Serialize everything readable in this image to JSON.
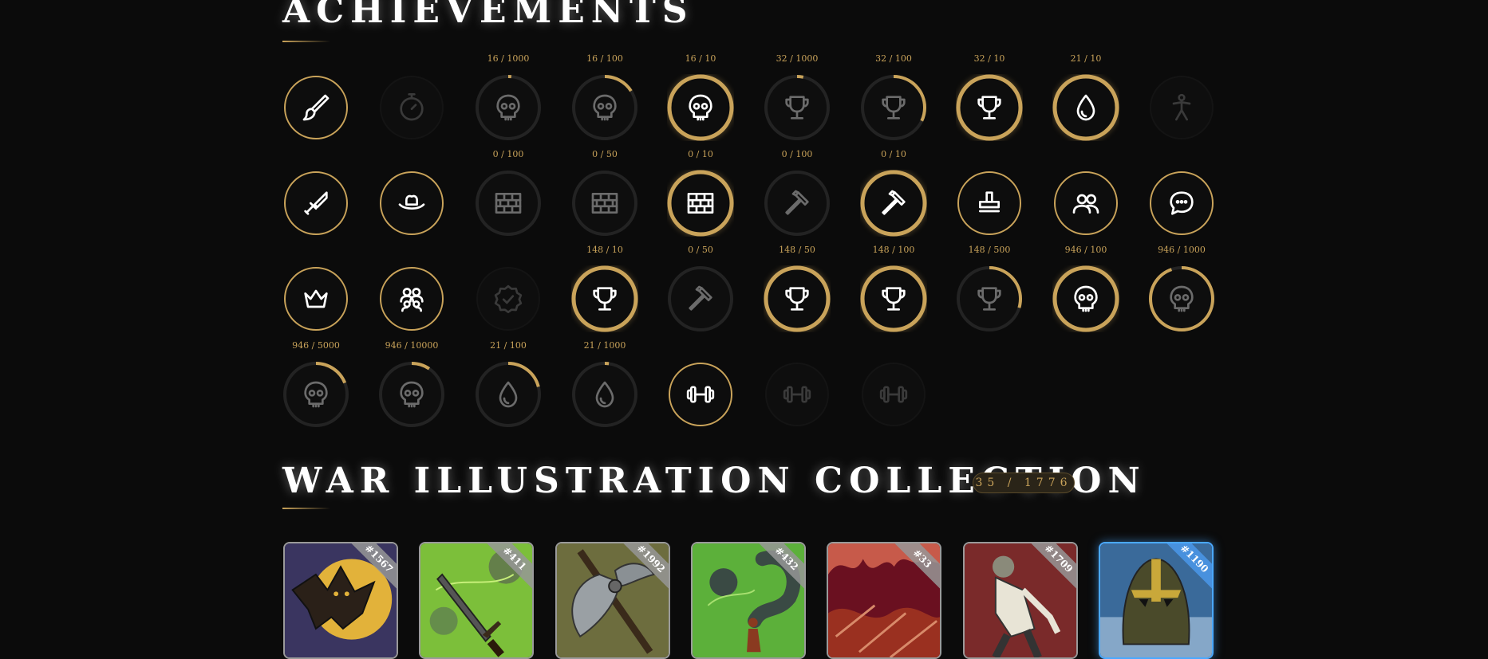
{
  "achievements": {
    "title": "ACHIEVEMENTS",
    "badges": [
      {
        "icon": "brush-icon",
        "label": "",
        "state": "earned",
        "progress": 1
      },
      {
        "icon": "stopwatch-icon",
        "label": "",
        "state": "locked",
        "progress": 0
      },
      {
        "icon": "skull-icon",
        "label": "16 / 1000",
        "state": "progress",
        "progress": 0.016
      },
      {
        "icon": "skull-icon",
        "label": "16 / 100",
        "state": "progress",
        "progress": 0.16
      },
      {
        "icon": "skull-icon",
        "label": "16 / 10",
        "state": "complete",
        "progress": 1
      },
      {
        "icon": "trophy-icon",
        "label": "32 / 1000",
        "state": "progress",
        "progress": 0.032
      },
      {
        "icon": "trophy-icon",
        "label": "32 / 100",
        "state": "progress",
        "progress": 0.32
      },
      {
        "icon": "trophy-icon",
        "label": "32 / 10",
        "state": "complete",
        "progress": 1
      },
      {
        "icon": "drop-icon",
        "label": "21 / 10",
        "state": "complete",
        "progress": 1
      },
      {
        "icon": "person-icon",
        "label": "",
        "state": "locked",
        "progress": 0
      },
      {
        "icon": "sword-icon",
        "label": "",
        "state": "earned",
        "progress": 1
      },
      {
        "icon": "hat-icon",
        "label": "",
        "state": "earned",
        "progress": 1
      },
      {
        "icon": "brick-wall-icon",
        "label": "0 / 100",
        "state": "progress",
        "progress": 0
      },
      {
        "icon": "brick-wall-icon",
        "label": "0 / 50",
        "state": "progress",
        "progress": 0
      },
      {
        "icon": "brick-wall-icon",
        "label": "0 / 10",
        "state": "complete",
        "progress": 1
      },
      {
        "icon": "hammer-icon",
        "label": "0 / 100",
        "state": "progress",
        "progress": 0
      },
      {
        "icon": "hammer-icon",
        "label": "0 / 10",
        "state": "complete",
        "progress": 1
      },
      {
        "icon": "stamp-icon",
        "label": "",
        "state": "earned",
        "progress": 1
      },
      {
        "icon": "users-icon",
        "label": "",
        "state": "earned",
        "progress": 1
      },
      {
        "icon": "chat-icon",
        "label": "",
        "state": "earned",
        "progress": 1
      },
      {
        "icon": "crown-icon",
        "label": "",
        "state": "earned",
        "progress": 1
      },
      {
        "icon": "group-icon",
        "label": "",
        "state": "earned",
        "progress": 1
      },
      {
        "icon": "verified-badge-icon",
        "label": "",
        "state": "locked",
        "progress": 0
      },
      {
        "icon": "trophy-icon",
        "label": "148 / 10",
        "state": "complete",
        "progress": 1
      },
      {
        "icon": "hammer-icon",
        "label": "0 / 50",
        "state": "progress",
        "progress": 0
      },
      {
        "icon": "trophy-icon",
        "label": "148 / 50",
        "state": "complete",
        "progress": 1
      },
      {
        "icon": "trophy-icon",
        "label": "148 / 100",
        "state": "complete",
        "progress": 1
      },
      {
        "icon": "trophy-icon",
        "label": "148 / 500",
        "state": "progress",
        "progress": 0.296
      },
      {
        "icon": "skull-icon",
        "label": "946 / 100",
        "state": "complete",
        "progress": 1
      },
      {
        "icon": "skull-icon",
        "label": "946 / 1000",
        "state": "progress",
        "progress": 0.946
      },
      {
        "icon": "skull-icon",
        "label": "946 / 5000",
        "state": "progress",
        "progress": 0.189
      },
      {
        "icon": "skull-icon",
        "label": "946 / 10000",
        "state": "progress",
        "progress": 0.095
      },
      {
        "icon": "drop-icon",
        "label": "21 / 100",
        "state": "progress",
        "progress": 0.21
      },
      {
        "icon": "drop-icon",
        "label": "21 / 1000",
        "state": "progress",
        "progress": 0.021
      },
      {
        "icon": "dumbbell-icon",
        "label": "",
        "state": "earned",
        "progress": 1
      },
      {
        "icon": "dumbbell-icon",
        "label": "",
        "state": "locked",
        "progress": 0
      },
      {
        "icon": "dumbbell-icon",
        "label": "",
        "state": "locked",
        "progress": 0
      }
    ]
  },
  "war_collection": {
    "title": "WAR ILLUSTRATION COLLECTION",
    "count": "35 / 1776",
    "cards": [
      {
        "number": "#1567",
        "art": "bat",
        "frame": "silver"
      },
      {
        "number": "#411",
        "art": "sword",
        "frame": "silver"
      },
      {
        "number": "#1992",
        "art": "axe",
        "frame": "silver"
      },
      {
        "number": "#432",
        "art": "giant",
        "frame": "silver"
      },
      {
        "number": "#33",
        "art": "flames",
        "frame": "silver"
      },
      {
        "number": "#1709",
        "art": "man",
        "frame": "silver"
      },
      {
        "number": "#1190",
        "art": "helmet",
        "frame": "blue"
      }
    ]
  },
  "colors": {
    "gold": "#c9a35a",
    "background": "#0b0b0b",
    "track": "#232323",
    "blue_frame": "#4aa8ff"
  }
}
